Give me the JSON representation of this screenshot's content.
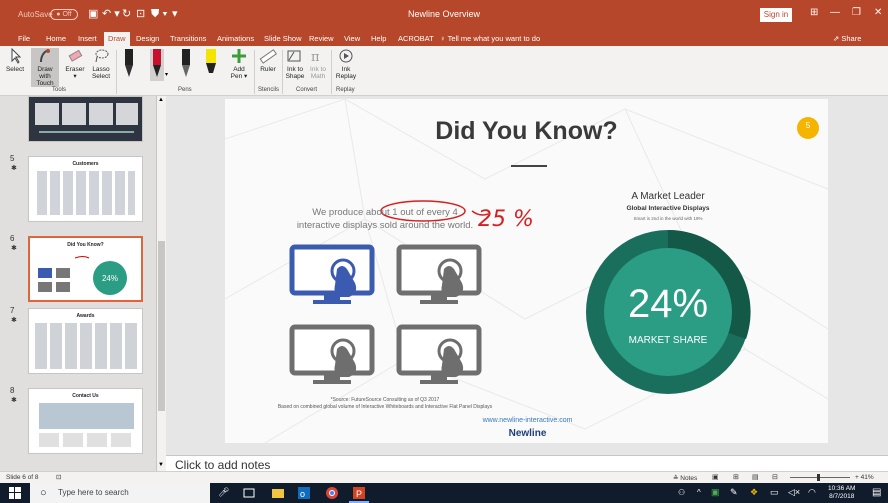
{
  "titlebar": {
    "autosave": "AutoSave",
    "toggle": "● Off",
    "title": "Newline Overview",
    "signin": "Sign in",
    "qat": [
      "▣",
      "↶ ▾",
      "↻",
      "⊡",
      "⛊ ▾",
      "▾"
    ]
  },
  "tabs": [
    "File",
    "Home",
    "Insert",
    "Draw",
    "Design",
    "Transitions",
    "Animations",
    "Slide Show",
    "Review",
    "View",
    "Help",
    "ACROBAT"
  ],
  "tell_me": "♀ Tell me what you want to do",
  "share": "⇗ Share",
  "ribbon": {
    "tools": [
      {
        "l1": "Select",
        "l2": ""
      },
      {
        "l1": "Draw with",
        "l2": "Touch"
      },
      {
        "l1": "Eraser",
        "l2": "▾"
      },
      {
        "l1": "Lasso",
        "l2": "Select"
      }
    ],
    "add_pen": [
      "Add",
      "Pen ▾"
    ],
    "ruler": "Ruler",
    "convert": [
      {
        "l1": "Ink to",
        "l2": "Shape"
      },
      {
        "l1": "Ink to",
        "l2": "Math"
      }
    ],
    "replay": [
      "Ink",
      "Replay"
    ],
    "groups": {
      "tools": "Tools",
      "pens": "Pens",
      "stencils": "Stencils",
      "convert": "Convert",
      "replay": "Replay"
    },
    "pen_colors": [
      "#222222",
      "#c8102e",
      "#222222",
      "#f5e400"
    ]
  },
  "thumbnails": [
    {
      "num": "5",
      "title": "Customers"
    },
    {
      "num": "6",
      "title": "Did You Know?",
      "selected": true
    },
    {
      "num": "7",
      "title": "Awards"
    },
    {
      "num": "8",
      "title": "Contact Us"
    }
  ],
  "slide": {
    "title": "Did You Know?",
    "badge": "5",
    "text_line1": "We produce about 1 out of every 4",
    "text_line2": "interactive displays sold around the world.",
    "handwriting": "25 %",
    "leader_title": "A Market Leader",
    "leader_sub": "Global Interactive Displays",
    "leader_tiny": "Smart is 2nd in the world with 19%",
    "percent": "24%",
    "market_share": "MARKET SHARE",
    "source1": "*Source: FutureSource Consulting as of Q3 2017",
    "source2": "Based on combined global volume of Interactive Whiteboards and Interactive Flat Panel Displays",
    "url": "www.newline-interactive.com",
    "logo": "Newline",
    "colors": {
      "teal": "#2a9d84",
      "dark_teal": "#1a6f5c",
      "blue": "#3b5bb0",
      "gray": "#6e6e6e",
      "accent": "#f5b400"
    }
  },
  "notes_placeholder": "Click to add notes",
  "status": {
    "slide": "Slide 6 of 8",
    "notes": "≙ Notes",
    "zoom": "+ 41%"
  },
  "taskbar": {
    "search": "Type here to search",
    "time": "10:36 AM",
    "date": "8/7/2018"
  }
}
